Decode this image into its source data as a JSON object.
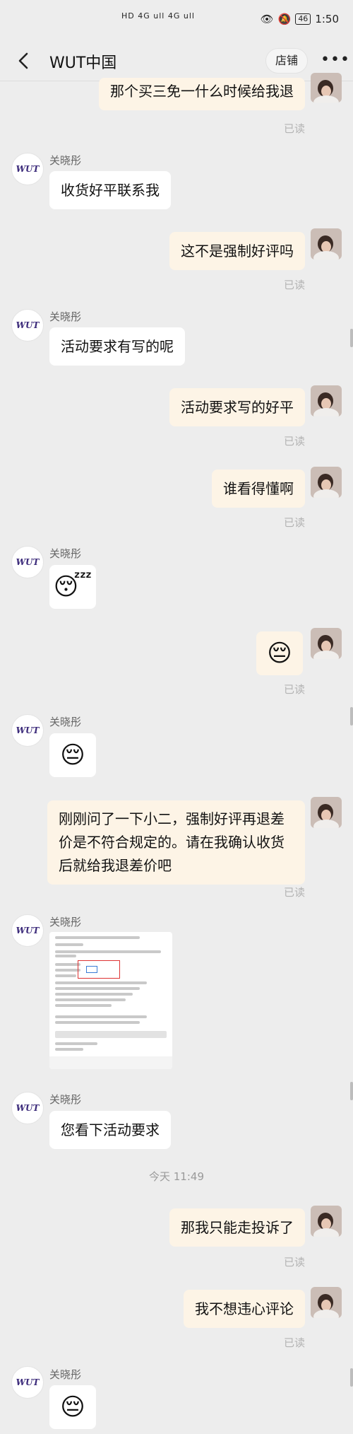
{
  "status_bar": {
    "signal": "HD 4G ull 4G ull",
    "eye": "👁",
    "battery": "46",
    "time": "1:50"
  },
  "header": {
    "title": "WUT中国",
    "shop_button": "店铺"
  },
  "contact": {
    "name": "关晓彤",
    "avatar_text": "WUT"
  },
  "read_label": "已读",
  "messages": {
    "m1": "那个买三免一什么时候给我退",
    "m2": "收货好平联系我",
    "m3": "这不是强制好评吗",
    "m4": "活动要求有写的呢",
    "m5": "活动要求写的好平",
    "m6": "谁看得懂啊",
    "m7_emoji": "😴",
    "m8_emoji": "😔",
    "m9_emoji": "😔",
    "m10": "刚刚问了一下小二，强制好评再退差价是不符合规定的。请在我确认收货后就给我退差价吧",
    "m12": "您看下活动要求",
    "time_sep": "今天 11:49",
    "m13": "那我只能走投诉了",
    "m14": "我不想违心评论",
    "m15_emoji": "😔"
  }
}
